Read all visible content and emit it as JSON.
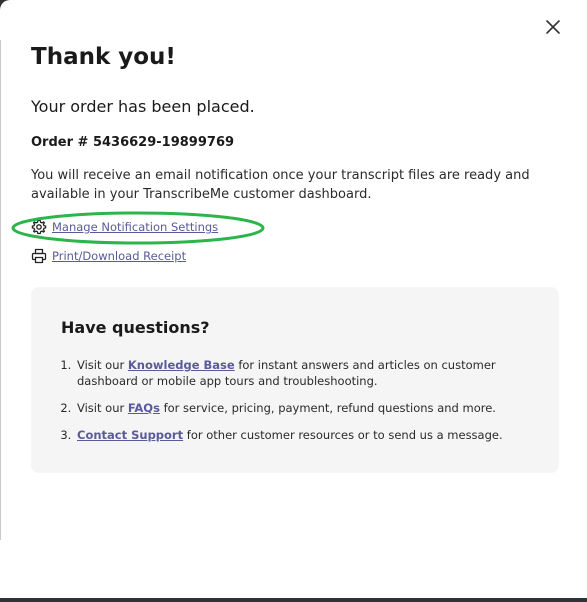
{
  "dialog": {
    "title": "Thank you!",
    "subtitle": "Your order has been placed.",
    "order_label": "Order #",
    "order_number": "5436629-19899769",
    "info_text": "You will receive an email notification once your transcript files are ready and available in your TranscribeMe customer dashboard.",
    "close_icon": "close-icon"
  },
  "links": {
    "notification_settings": {
      "label": "Manage Notification Settings",
      "icon": "gear-icon"
    },
    "receipt": {
      "label": "Print/Download Receipt",
      "icon": "printer-icon"
    }
  },
  "questions": {
    "title": "Have questions?",
    "items": [
      {
        "prefix": "Visit our ",
        "link": "Knowledge Base",
        "suffix": " for instant answers and articles on customer dashboard or mobile app tours and troubleshooting."
      },
      {
        "prefix": "Visit our ",
        "link": "FAQs",
        "suffix": " for service, pricing, payment, refund questions and more."
      },
      {
        "prefix": "",
        "link": "Contact Support",
        "suffix": " for other customer resources or to send us a message."
      }
    ]
  },
  "colors": {
    "link": "#5a5a9a",
    "highlight": "#2bb54a",
    "panel_bg": "#f5f5f5"
  }
}
